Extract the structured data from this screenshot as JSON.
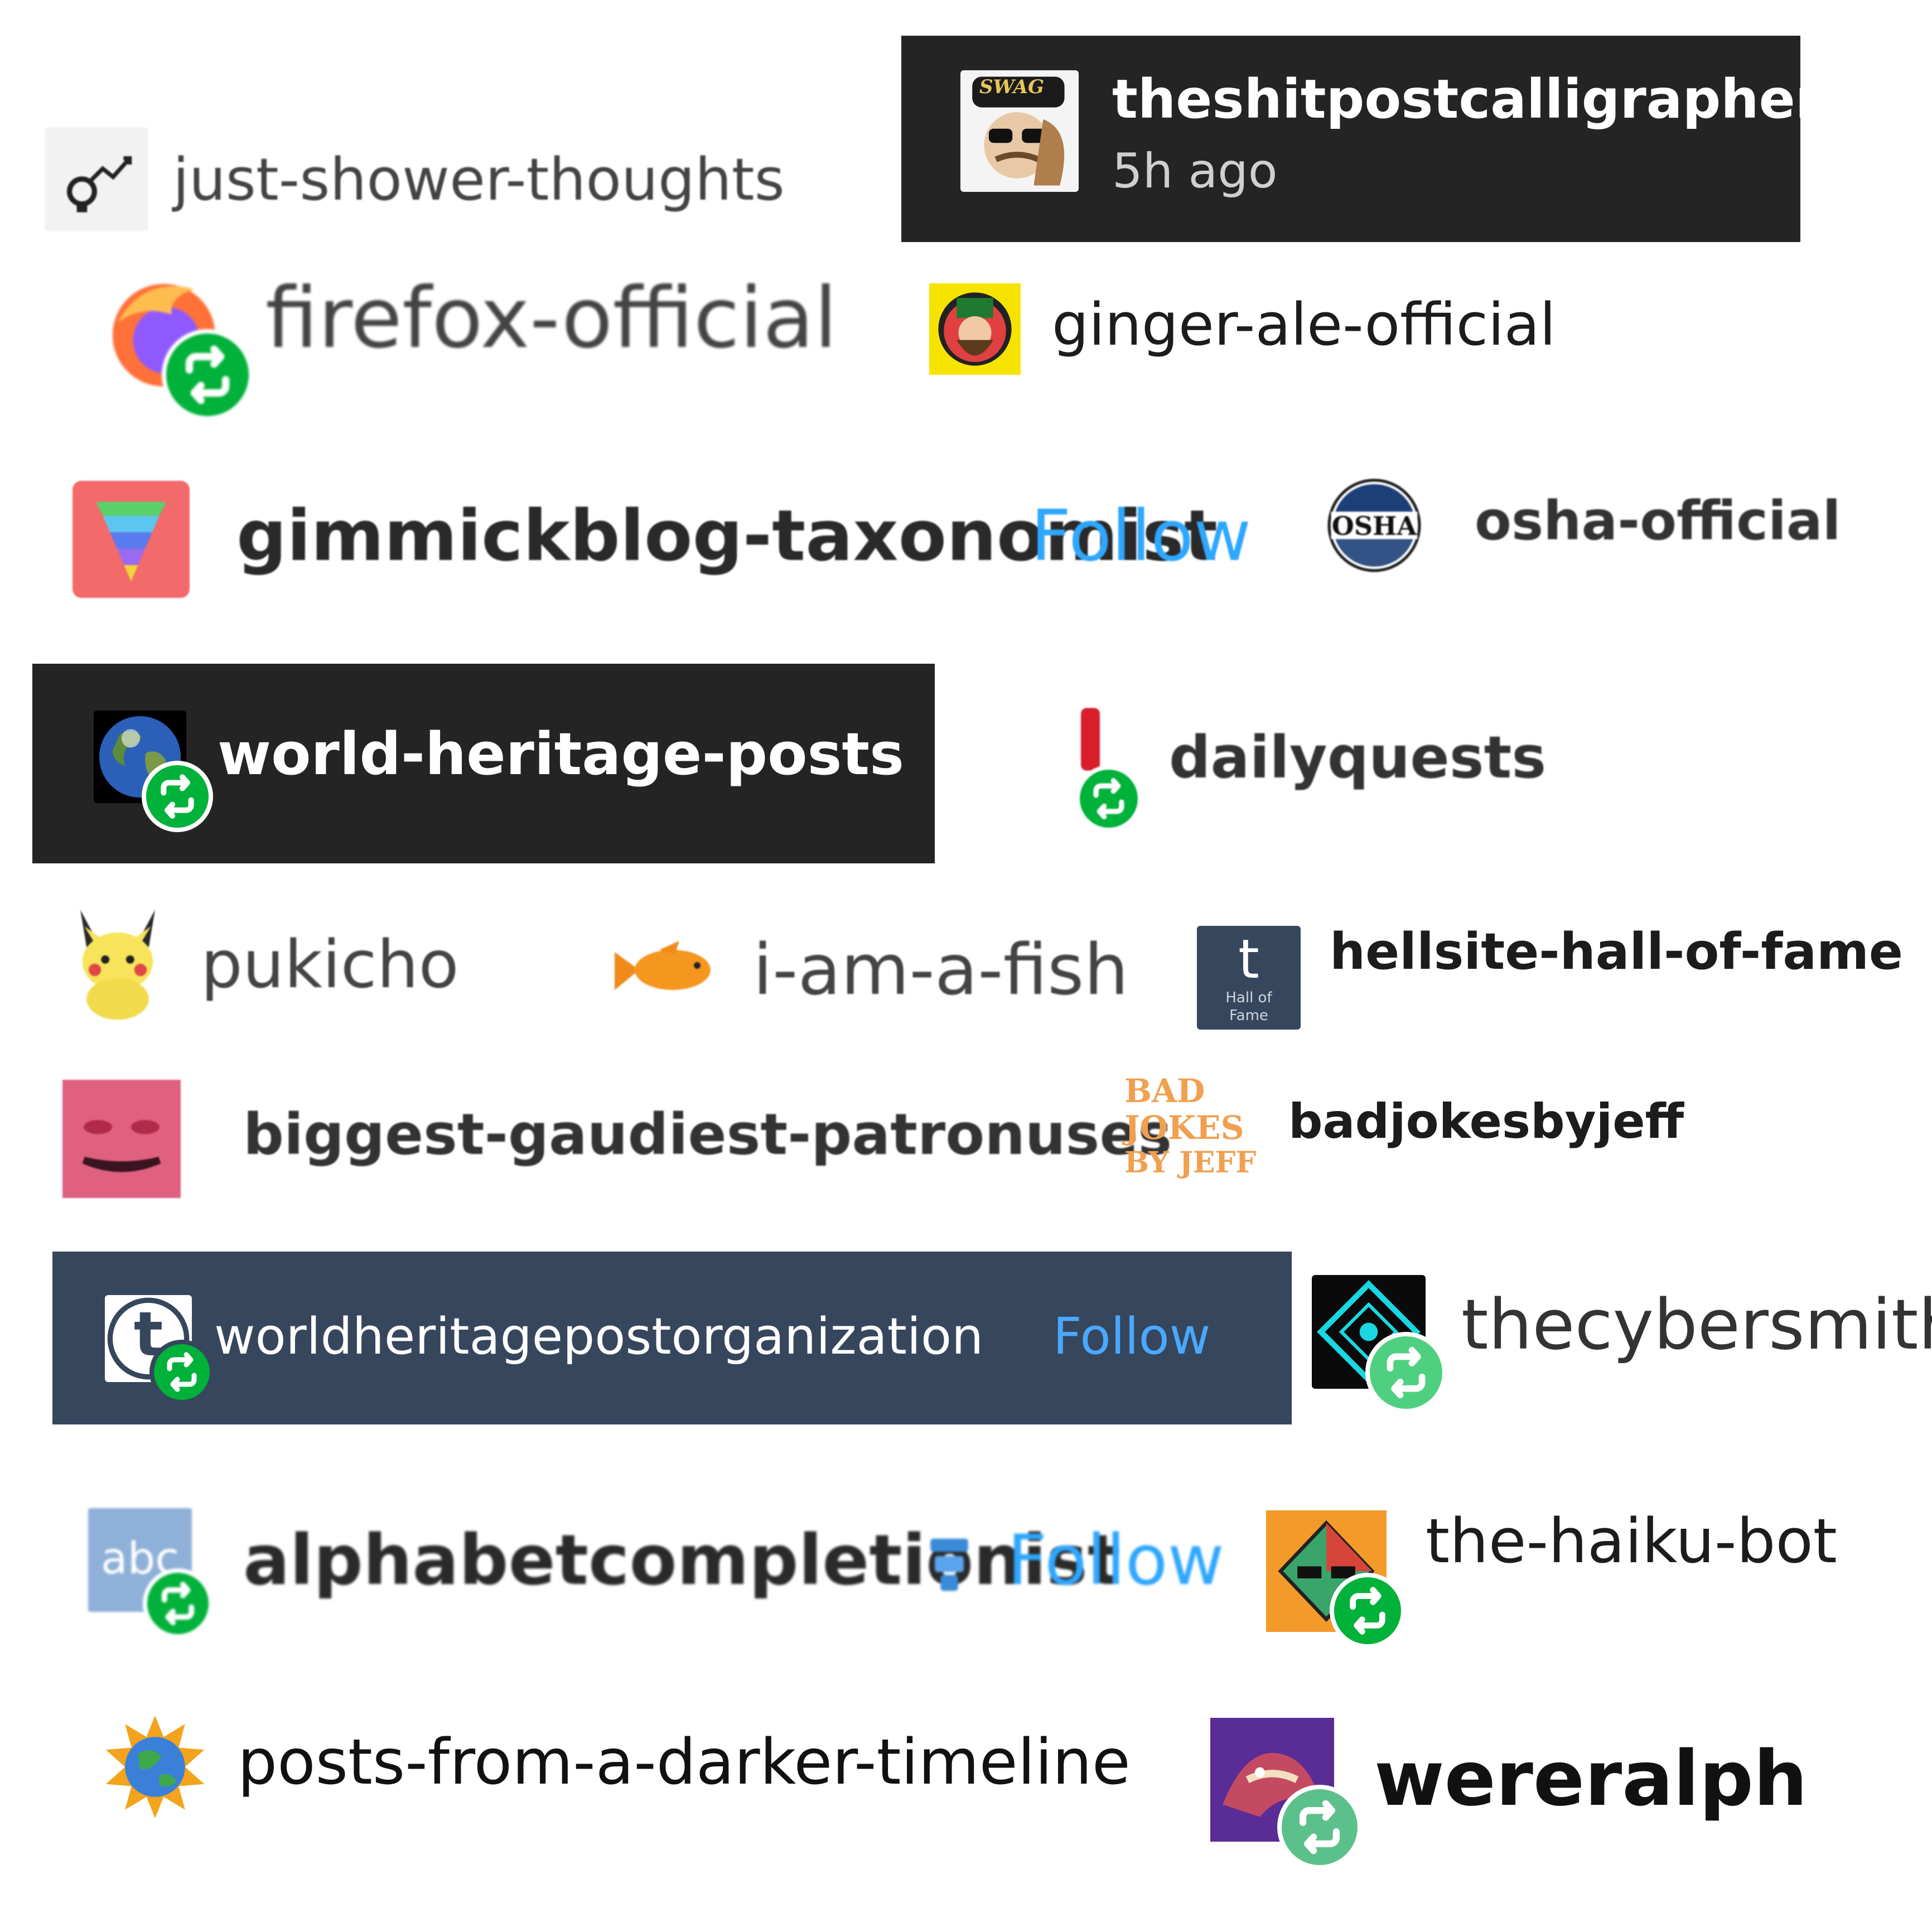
{
  "blogs": [
    {
      "name": "just-shower-thoughts"
    },
    {
      "name": "theshitpostcalligrapher",
      "time": "5h ago",
      "avatar_text": "SWAG"
    },
    {
      "name": "firefox-official"
    },
    {
      "name": "ginger-ale-official"
    },
    {
      "name": "gimmickblog-taxonomist",
      "follow": "Follow"
    },
    {
      "name": "osha-official",
      "avatar_text": "OSHA"
    },
    {
      "name": "world-heritage-posts"
    },
    {
      "name": "dailyquests"
    },
    {
      "name": "pukicho"
    },
    {
      "name": "i-am-a-fish"
    },
    {
      "name": "hellsite-hall-of-fame",
      "avatar_text_1": "t",
      "avatar_text_2": "Hall of",
      "avatar_text_3": "Fame"
    },
    {
      "name": "biggest-gaudiest-patronuses"
    },
    {
      "name": "badjokesbyjeff",
      "avatar_text_1": "BAD",
      "avatar_text_2": "JOKES",
      "avatar_text_3": "BY JEFF"
    },
    {
      "name": "worldheritagepostorganization",
      "follow": "Follow",
      "avatar_text": "t"
    },
    {
      "name": "thecybersmith"
    },
    {
      "name": "alphabetcompletionist",
      "follow": "Follow",
      "avatar_text": "abc"
    },
    {
      "name": "the-haiku-bot"
    },
    {
      "name": "posts-from-a-darker-timeline"
    },
    {
      "name": "wereralph"
    }
  ],
  "colors": {
    "reblog_badge": "#00b13a",
    "follow_link": "#2ea7ff",
    "dark_panel": "#242424",
    "navy_panel": "#36465d"
  }
}
